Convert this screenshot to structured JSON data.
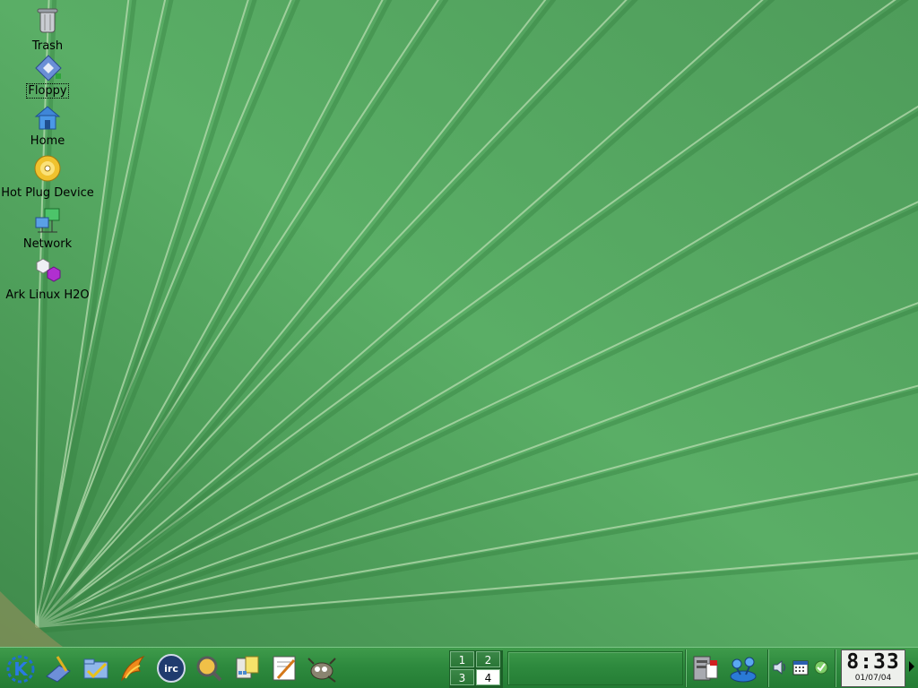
{
  "desktop": {
    "icons": [
      {
        "label": "Trash",
        "icon": "trash-icon"
      },
      {
        "label": "Floppy",
        "icon": "floppy-icon"
      },
      {
        "label": "Home",
        "icon": "home-icon"
      },
      {
        "label": "Hot Plug Device",
        "icon": "cd-icon"
      },
      {
        "label": "Network",
        "icon": "network-icon"
      },
      {
        "label": "Ark Linux H2O",
        "icon": "ark-linux-icon"
      }
    ]
  },
  "taskbar": {
    "launchers": [
      {
        "name": "kde-menu-icon"
      },
      {
        "name": "show-desktop-icon"
      },
      {
        "name": "file-manager-icon"
      },
      {
        "name": "web-browser-icon"
      },
      {
        "name": "irc-client-icon"
      },
      {
        "name": "search-icon"
      },
      {
        "name": "calculator-notes-icon"
      },
      {
        "name": "text-editor-icon"
      },
      {
        "name": "gimp-icon"
      }
    ],
    "pager": {
      "desktops": [
        "1",
        "2",
        "3",
        "4"
      ],
      "active": "4"
    },
    "tray": [
      "file-server-icon",
      "network-tool-icon",
      "volume-icon",
      "calendar-icon",
      "updater-icon"
    ],
    "clock": {
      "time": "8:33",
      "date": "01/07/04"
    }
  },
  "colors": {
    "wallpaper_green": "#5aa866",
    "taskbar_green": "#2e8a3e"
  }
}
